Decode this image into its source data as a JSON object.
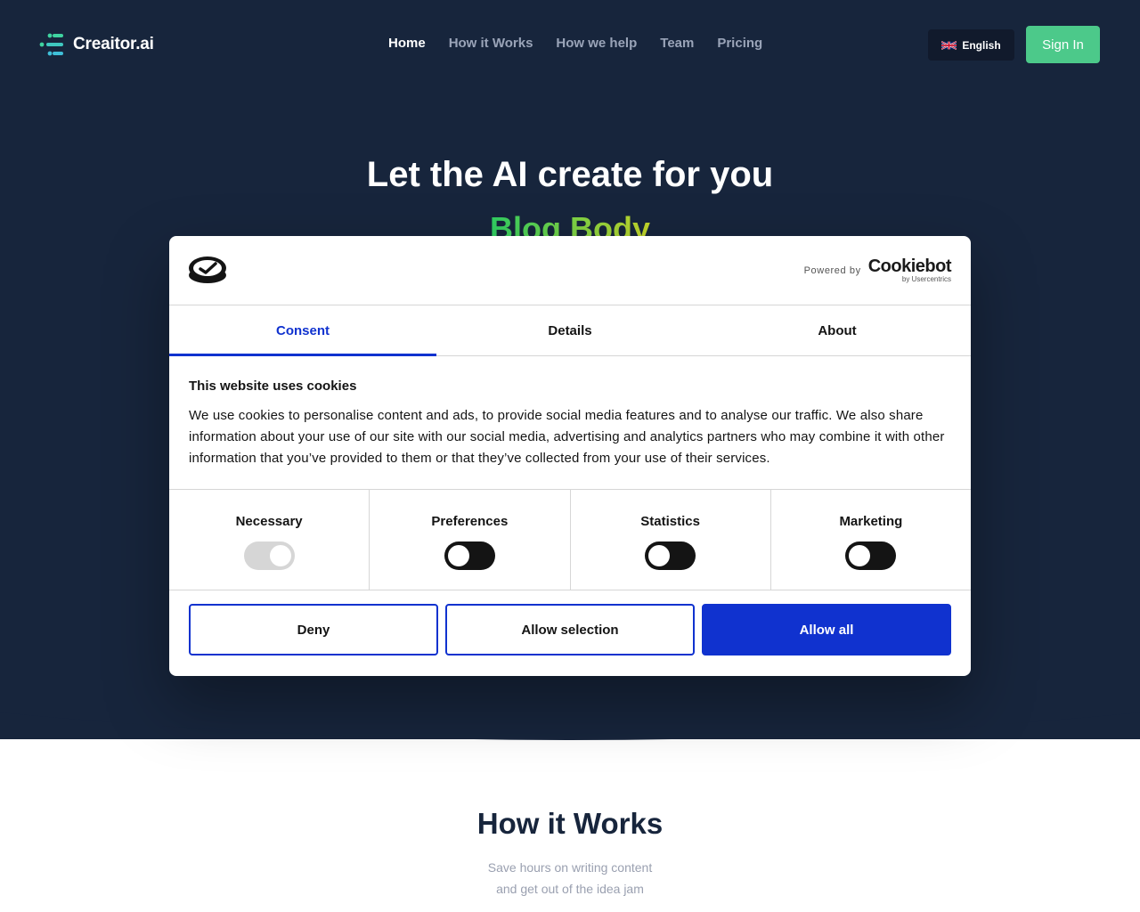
{
  "header": {
    "brand": "Creaitor.ai",
    "nav": [
      "Home",
      "How it Works",
      "How we help",
      "Team",
      "Pricing"
    ],
    "language": "English",
    "signin": "Sign In"
  },
  "hero": {
    "title": "Let the AI create for you",
    "rotating_word": "Blog Body"
  },
  "how_it_works": {
    "title": "How it Works",
    "subtitle_line1": "Save hours on writing content",
    "subtitle_line2": "and get out of the idea jam"
  },
  "cookie_dialog": {
    "powered_by": "Powered by",
    "cookiebot": "Cookiebot",
    "by_usercentrics": "by Usercentrics",
    "tabs": [
      "Consent",
      "Details",
      "About"
    ],
    "active_tab": "Consent",
    "heading": "This website uses cookies",
    "body": "We use cookies to personalise content and ads, to provide social media features and to analyse our traffic. We also share information about your use of our site with our social media, advertising and analytics partners who may combine it with other information that you’ve provided to them or that they’ve collected from your use of their services.",
    "toggles": [
      {
        "label": "Necessary",
        "state": "on",
        "disabled": true
      },
      {
        "label": "Preferences",
        "state": "off",
        "disabled": false
      },
      {
        "label": "Statistics",
        "state": "off",
        "disabled": false
      },
      {
        "label": "Marketing",
        "state": "off",
        "disabled": false
      }
    ],
    "buttons": {
      "deny": "Deny",
      "allow_selection": "Allow selection",
      "allow_all": "Allow all"
    }
  },
  "colors": {
    "hero_bg": "#17253c",
    "accent_green": "#4cc98a",
    "cookiebot_blue": "#1032cf"
  }
}
